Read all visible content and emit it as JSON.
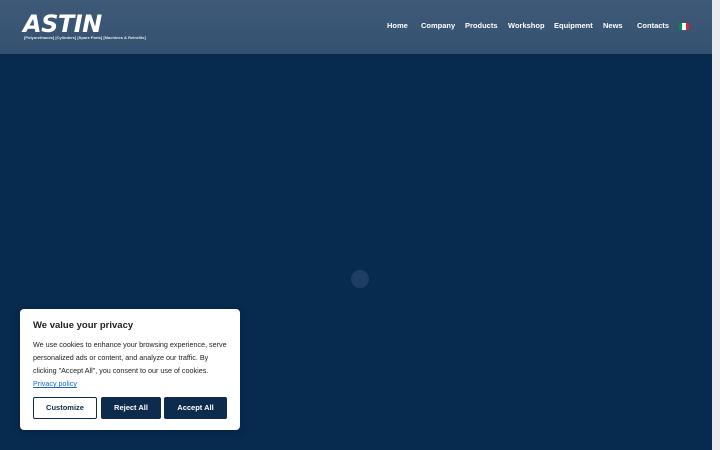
{
  "header": {
    "logo_text": "ASTIN",
    "logo_tagline": "[Polyurethanes]  [Cylinders]  [Spare Parts]  [Machines & Retrofits]",
    "nav": [
      {
        "label": "Home"
      },
      {
        "label": "Company"
      },
      {
        "label": "Products"
      },
      {
        "label": "Workshop"
      },
      {
        "label": "Equipment"
      },
      {
        "label": "News"
      },
      {
        "label": "Contacts"
      }
    ],
    "language_flag": "italian-flag-icon"
  },
  "hero": {
    "background_color": "#062b4f",
    "loader_icon": "loading-spinner-icon"
  },
  "cookie_banner": {
    "title": "We value your privacy",
    "body": "We use cookies to enhance your browsing experience, serve personalized ads or content, and analyze our traffic. By clicking \"Accept All\", you consent to our use of cookies.",
    "privacy_link": "Privacy policy",
    "buttons": {
      "customize": "Customize",
      "reject": "Reject All",
      "accept": "Accept All"
    },
    "button_color": "#0d2b4d",
    "link_color": "#1863dc"
  },
  "colors": {
    "header_bg": "#3e5a78",
    "page_bg": "#062b4f"
  }
}
